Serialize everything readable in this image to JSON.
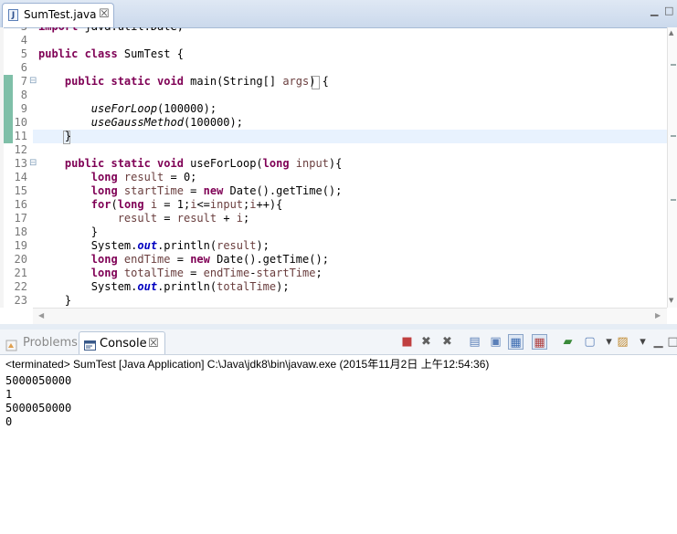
{
  "editor": {
    "tab": {
      "label": "SumTest.java",
      "icon": "java-file-icon",
      "close": "☒",
      "icon_letter": "J"
    },
    "window_controls": {
      "minimize": "▁",
      "maximize": "□"
    },
    "lines": [
      {
        "num": "3",
        "tokens": [
          {
            "t": "import java.util.Date;",
            "c": "kw-import"
          }
        ]
      },
      {
        "num": "4",
        "tokens": []
      },
      {
        "num": "5",
        "tokens": [
          {
            "t": "public class ",
            "c": "kw"
          },
          {
            "t": "SumTest {",
            "c": ""
          }
        ]
      },
      {
        "num": "6",
        "tokens": []
      },
      {
        "num": "7",
        "tokens": [
          {
            "t": "    public static void ",
            "c": "kw"
          },
          {
            "t": "main(String[] ",
            "c": ""
          },
          {
            "t": "args",
            "c": "vr"
          },
          {
            "t": ") {",
            "c": ""
          }
        ]
      },
      {
        "num": "8",
        "tokens": []
      },
      {
        "num": "9",
        "tokens": [
          {
            "t": "        ",
            "c": ""
          },
          {
            "t": "useForLoop",
            "c": "it"
          },
          {
            "t": "(100000);",
            "c": ""
          }
        ]
      },
      {
        "num": "10",
        "tokens": [
          {
            "t": "        ",
            "c": ""
          },
          {
            "t": "useGaussMethod",
            "c": "it"
          },
          {
            "t": "(100000);",
            "c": ""
          }
        ]
      },
      {
        "num": "11",
        "tokens": [
          {
            "t": "    }",
            "c": ""
          }
        ]
      },
      {
        "num": "12",
        "tokens": []
      },
      {
        "num": "13",
        "tokens": [
          {
            "t": "    public static void ",
            "c": "kw"
          },
          {
            "t": "useForLoop(",
            "c": ""
          },
          {
            "t": "long ",
            "c": "kw"
          },
          {
            "t": "input",
            "c": "vr"
          },
          {
            "t": "){",
            "c": ""
          }
        ]
      },
      {
        "num": "14",
        "tokens": [
          {
            "t": "        ",
            "c": ""
          },
          {
            "t": "long ",
            "c": "kw"
          },
          {
            "t": "result",
            "c": "vr"
          },
          {
            "t": " = 0;",
            "c": ""
          }
        ]
      },
      {
        "num": "15",
        "tokens": [
          {
            "t": "        ",
            "c": ""
          },
          {
            "t": "long ",
            "c": "kw"
          },
          {
            "t": "startTime",
            "c": "vr"
          },
          {
            "t": " = ",
            "c": ""
          },
          {
            "t": "new ",
            "c": "kw"
          },
          {
            "t": "Date().getTime();",
            "c": ""
          }
        ]
      },
      {
        "num": "16",
        "tokens": [
          {
            "t": "        ",
            "c": ""
          },
          {
            "t": "for",
            "c": "kw"
          },
          {
            "t": "(",
            "c": ""
          },
          {
            "t": "long ",
            "c": "kw"
          },
          {
            "t": "i",
            "c": "vr"
          },
          {
            "t": " = 1;",
            "c": ""
          },
          {
            "t": "i",
            "c": "vr"
          },
          {
            "t": "<=",
            "c": ""
          },
          {
            "t": "input",
            "c": "vr"
          },
          {
            "t": ";",
            "c": ""
          },
          {
            "t": "i",
            "c": "vr"
          },
          {
            "t": "++){",
            "c": ""
          }
        ]
      },
      {
        "num": "17",
        "tokens": [
          {
            "t": "            ",
            "c": ""
          },
          {
            "t": "result",
            "c": "vr"
          },
          {
            "t": " = ",
            "c": ""
          },
          {
            "t": "result",
            "c": "vr"
          },
          {
            "t": " + ",
            "c": ""
          },
          {
            "t": "i",
            "c": "vr"
          },
          {
            "t": ";",
            "c": ""
          }
        ]
      },
      {
        "num": "18",
        "tokens": [
          {
            "t": "        }",
            "c": ""
          }
        ]
      },
      {
        "num": "19",
        "tokens": [
          {
            "t": "        System.",
            "c": ""
          },
          {
            "t": "out",
            "c": "fld"
          },
          {
            "t": ".println(",
            "c": ""
          },
          {
            "t": "result",
            "c": "vr"
          },
          {
            "t": ");",
            "c": ""
          }
        ]
      },
      {
        "num": "20",
        "tokens": [
          {
            "t": "        ",
            "c": ""
          },
          {
            "t": "long ",
            "c": "kw"
          },
          {
            "t": "endTime",
            "c": "vr"
          },
          {
            "t": " = ",
            "c": ""
          },
          {
            "t": "new ",
            "c": "kw"
          },
          {
            "t": "Date().getTime();",
            "c": ""
          }
        ]
      },
      {
        "num": "21",
        "tokens": [
          {
            "t": "        ",
            "c": ""
          },
          {
            "t": "long ",
            "c": "kw"
          },
          {
            "t": "totalTime",
            "c": "vr"
          },
          {
            "t": " = ",
            "c": ""
          },
          {
            "t": "endTime",
            "c": "vr"
          },
          {
            "t": "-",
            "c": ""
          },
          {
            "t": "startTime",
            "c": "vr"
          },
          {
            "t": ";",
            "c": ""
          }
        ]
      },
      {
        "num": "22",
        "tokens": [
          {
            "t": "        System.",
            "c": ""
          },
          {
            "t": "out",
            "c": "fld"
          },
          {
            "t": ".println(",
            "c": ""
          },
          {
            "t": "totalTime",
            "c": "vr"
          },
          {
            "t": ");",
            "c": ""
          }
        ]
      },
      {
        "num": "23",
        "tokens": [
          {
            "t": "    }",
            "c": ""
          }
        ]
      }
    ],
    "fold_markers": {
      "7": "⊟",
      "13": "⊟"
    },
    "current_line": "11",
    "changed_lines": [
      "7",
      "8",
      "9",
      "10",
      "11"
    ]
  },
  "console": {
    "tabs": [
      {
        "label": "Problems",
        "icon": "problems-icon",
        "active": false
      },
      {
        "label": "Console",
        "icon": "console-icon",
        "active": true,
        "close": "☒"
      }
    ],
    "toolbar": [
      {
        "name": "terminate-icon",
        "glyph": "■"
      },
      {
        "name": "remove-launch-icon",
        "glyph": "✖"
      },
      {
        "name": "remove-all-terminated-icon",
        "glyph": "✖"
      },
      {
        "name": "clear-console-icon",
        "glyph": "▤"
      },
      {
        "name": "scroll-lock-icon",
        "glyph": "▣"
      },
      {
        "name": "show-on-output-icon",
        "glyph": "▦"
      },
      {
        "name": "show-on-error-icon",
        "glyph": "▦"
      },
      {
        "name": "pin-console-icon",
        "glyph": "▰"
      },
      {
        "name": "display-selected-console-icon",
        "glyph": "▢"
      },
      {
        "name": "display-selected-console-dropdown-icon",
        "glyph": "▾"
      },
      {
        "name": "open-console-icon",
        "glyph": "▨"
      },
      {
        "name": "open-console-dropdown-icon",
        "glyph": "▾"
      },
      {
        "name": "minimize-view-icon",
        "glyph": "▁"
      },
      {
        "name": "maximize-view-icon",
        "glyph": "□"
      }
    ],
    "status": "<terminated> SumTest [Java Application] C:\\Java\\jdk8\\bin\\javaw.exe (2015年11月2日 上午12:54:36)",
    "output": [
      "5000050000",
      "1",
      "5000050000",
      "0"
    ]
  }
}
